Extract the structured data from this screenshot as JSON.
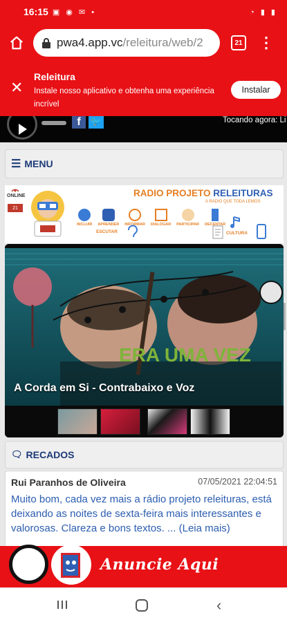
{
  "status_bar": {
    "time": "16:15",
    "notif_icons": "photo message whatsapp mail dot",
    "right_icons": "wifi signal battery"
  },
  "browser": {
    "url_host": "pwa4.app.vc",
    "url_path": "/releitura/web/2",
    "tab_count": "21"
  },
  "install_banner": {
    "app_name": "Releitura",
    "description": "Instale nosso aplicativo e obtenha uma experiência incrível",
    "install_label": "Instalar"
  },
  "player": {
    "now_playing": "Tocando agora: Li"
  },
  "menu": {
    "label": "MENU"
  },
  "banner": {
    "online_label": "ONLINE",
    "online_count": "21",
    "title_part1": "RADIO PROJETO",
    "title_part2": "RELEITURAS",
    "subtitle": "A RADIO QUE TODA LEMOS",
    "items": [
      "INCLUIR",
      "APRENDER",
      "INFORMAR",
      "DIALOGAR",
      "PARTICIPAR",
      "DECENTAR"
    ],
    "escutar": "ESCUTAR",
    "cultura": "CULTURA"
  },
  "slide": {
    "caption": "A Corda em Si - Contrabaixo e Voz",
    "overlay_text": "ERA UMA VEZ"
  },
  "recados": {
    "label": "RECADOS",
    "messages": [
      {
        "author": "Rui Paranhos de Oliveira",
        "date": "07/05/2021 22:04:51",
        "text": "Muito bom, cada vez mais a rádio projeto releituras, está deixando as noites de sexta-feira mais interessantes e valorosas. Clareza e bons textos. ... (Leia mais)"
      }
    ]
  },
  "ad": {
    "text": "Anuncie Aqui"
  },
  "colors": {
    "brand_red": "#e81116",
    "link_blue": "#2b5db0",
    "heading_navy": "#1c3a78"
  }
}
